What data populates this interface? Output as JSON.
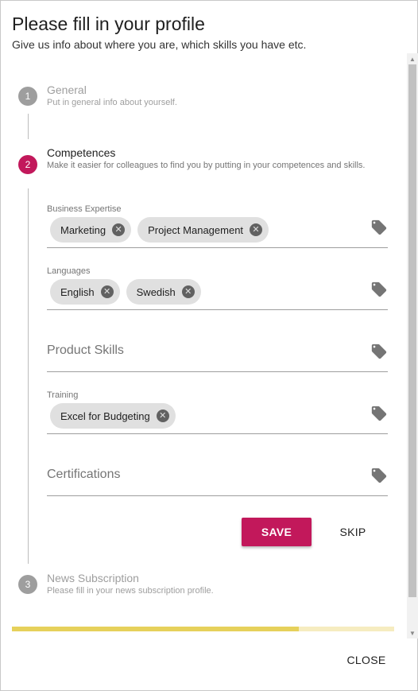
{
  "dialog": {
    "title": "Please fill in your profile",
    "subtitle": "Give us info about where you are, which skills you have etc."
  },
  "steps": [
    {
      "number": "1",
      "title": "General",
      "description": "Put in general info about yourself.",
      "state": "inactive"
    },
    {
      "number": "2",
      "title": "Competences",
      "description": "Make it easier for colleagues to find you by putting in your competences and skills.",
      "state": "active"
    },
    {
      "number": "3",
      "title": "News Subscription",
      "description": "Please fill in your news subscription profile.",
      "state": "inactive"
    }
  ],
  "fields": {
    "business_expertise": {
      "label": "Business Expertise",
      "chips": [
        "Marketing",
        "Project Management"
      ]
    },
    "languages": {
      "label": "Languages",
      "chips": [
        "English",
        "Swedish"
      ]
    },
    "product_skills": {
      "placeholder": "Product Skills"
    },
    "training": {
      "label": "Training",
      "chips": [
        "Excel for Budgeting"
      ]
    },
    "certifications": {
      "placeholder": "Certifications"
    }
  },
  "actions": {
    "save_label": "SAVE",
    "skip_label": "SKIP",
    "close_label": "CLOSE"
  },
  "progress": {
    "fraction": 0.75
  },
  "icons": {
    "tag": "tag-icon",
    "chip_remove": "cancel-circle-icon"
  },
  "colors": {
    "accent": "#c2185b",
    "progress_fill": "#e6d15b",
    "progress_track": "#f6ecc0",
    "chip": "#e0e0e0"
  }
}
